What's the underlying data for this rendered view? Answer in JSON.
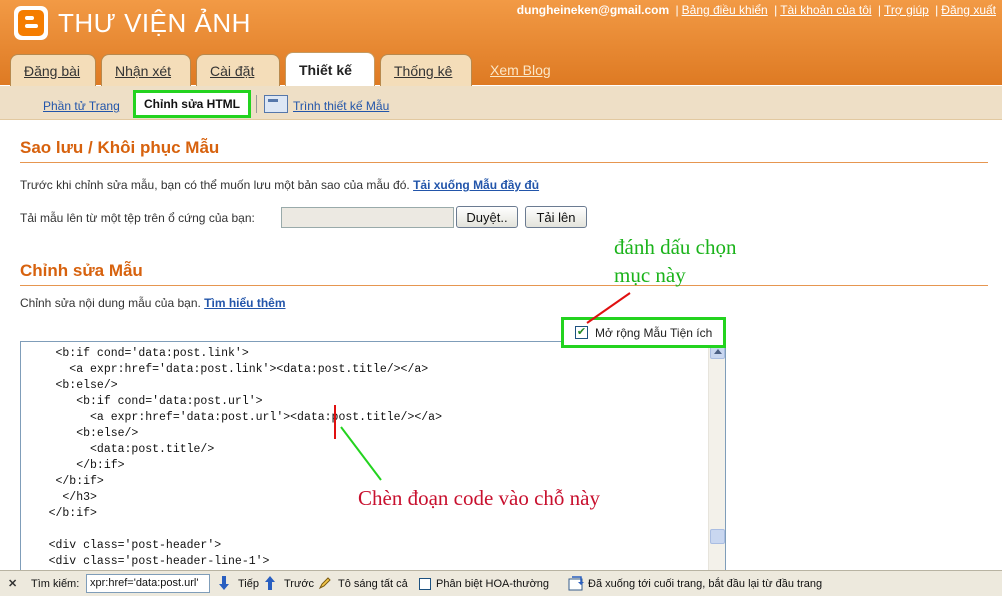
{
  "header": {
    "blog_title": "THƯ VIỆN ẢNH",
    "user_email": "dungheineken@gmail.com",
    "links": [
      "Bảng điều khiển",
      "Tài khoản của tôi",
      "Trợ giúp",
      "Đăng xuất"
    ]
  },
  "tabs": [
    {
      "label": "Đăng bài",
      "active": false
    },
    {
      "label": "Nhận xét",
      "active": false
    },
    {
      "label": "Cài đặt",
      "active": false
    },
    {
      "label": "Thiết kế",
      "active": true
    },
    {
      "label": "Thống kê",
      "active": false
    },
    {
      "label": "Xem Blog",
      "active": false
    }
  ],
  "subnav": {
    "page_elements": "Phần tử Trang",
    "edit_html": "Chỉnh sửa HTML",
    "template_designer": "Trình thiết kế Mẫu"
  },
  "backup": {
    "title": "Sao lưu / Khôi phục Mẫu",
    "description": "Trước khi chỉnh sửa mẫu, bạn có thể muốn lưu một bản sao của mẫu đó.",
    "download_link": "Tải xuống Mẫu đầy đủ",
    "upload_label": "Tải mẫu lên từ một tệp trên ổ cứng của bạn:",
    "browse_button": "Duyệt..",
    "upload_button": "Tải lên"
  },
  "edit": {
    "title": "Chỉnh sửa Mẫu",
    "description": "Chỉnh sửa nội dung mẫu của bạn.",
    "learn_more": "Tìm hiểu thêm",
    "expand_widgets_label": "Mở rộng Mẫu Tiện ích",
    "expand_widgets_checked": true
  },
  "code_lines": [
    "     <b:if cond='data:post.link'>",
    "       <a expr:href='data:post.link'><data:post.title/></a>",
    "     <b:else/>",
    "        <b:if cond='data:post.url'>",
    "          <a expr:href='data:post.url'><data:post.title/></a>",
    "        <b:else/>",
    "          <data:post.title/>",
    "        </b:if>",
    "     </b:if>",
    "      </h3>",
    "    </b:if>",
    "",
    "    <div class='post-header'>",
    "    <div class='post-header-line-1'>"
  ],
  "annotations": {
    "check_note_line1": "đánh dấu chọn",
    "check_note_line2": "mục này",
    "insert_note": "Chèn đoạn code vào chỗ này"
  },
  "findbar": {
    "close": "✕",
    "label": "Tìm kiếm:",
    "query": "xpr:href='data:post.url'",
    "next": "Tiếp",
    "prev": "Trước",
    "highlight_all": "Tô sáng tất cả",
    "match_case": "Phân biệt HOA-thường",
    "status": "Đã xuống tới cuối trang, bắt đầu lại từ đầu trang"
  }
}
